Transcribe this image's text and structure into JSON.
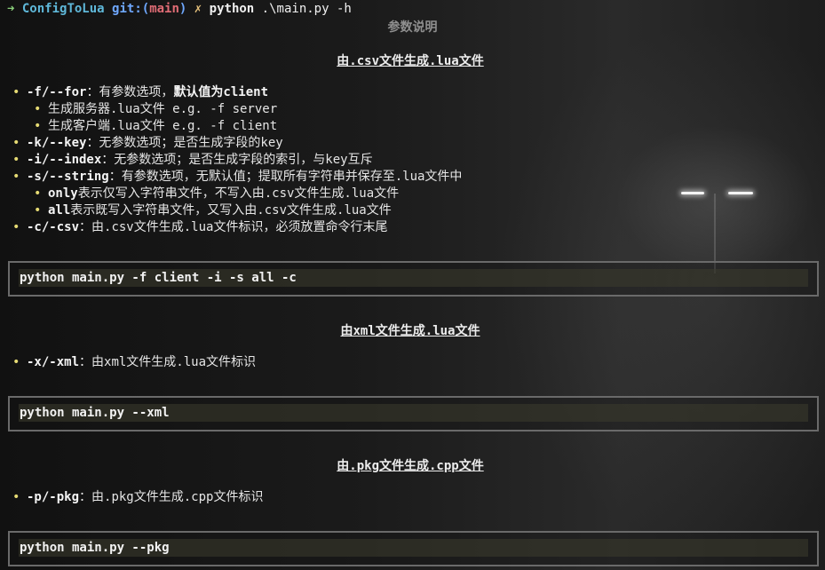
{
  "prompt": {
    "arrow": "➜",
    "dir": "ConfigToLua",
    "git": "git:",
    "branch_open": "(",
    "branch": "main",
    "branch_close": ")",
    "dirty": "✗",
    "command": "python",
    "args": ".\\main.py -h"
  },
  "doc": {
    "title": "参数说明",
    "sections": [
      {
        "heading": "由.csv文件生成.lua文件",
        "items": [
          {
            "flag": "-f/--for",
            "text": "：有参数选项，",
            "bold_text": "默认值为client"
          },
          {
            "sub": true,
            "text": "生成服务器.lua文件 e.g. -f server"
          },
          {
            "sub": true,
            "text": "生成客户端.lua文件 e.g. -f client"
          },
          {
            "flag": "-k/--key",
            "text": "：无参数选项；是否生成字段的key"
          },
          {
            "flag": "-i/--index",
            "text": "：无参数选项；是否生成字段的索引，与key互斥"
          },
          {
            "flag": "-s/--string",
            "text": "：有参数选项，无默认值；提取所有字符串并保存至.lua文件中"
          },
          {
            "sub": true,
            "flag": "only",
            "text": "表示仅写入字符串文件，不写入由.csv文件生成.lua文件"
          },
          {
            "sub": true,
            "flag": "all",
            "text": "表示既写入字符串文件，又写入由.csv文件生成.lua文件"
          },
          {
            "flag": "-c/-csv",
            "text": "：由.csv文件生成.lua文件标识，必须放置命令行末尾"
          }
        ],
        "code": "python main.py -f client -i -s all -c"
      },
      {
        "heading": "由xml文件生成.lua文件",
        "items": [
          {
            "flag": "-x/-xml",
            "text": "：由xml文件生成.lua文件标识"
          }
        ],
        "code": "python main.py --xml"
      },
      {
        "heading": "由.pkg文件生成.cpp文件",
        "items": [
          {
            "flag": "-p/-pkg",
            "text": "：由.pkg文件生成.cpp文件标识"
          }
        ],
        "code": "python main.py --pkg"
      }
    ]
  }
}
